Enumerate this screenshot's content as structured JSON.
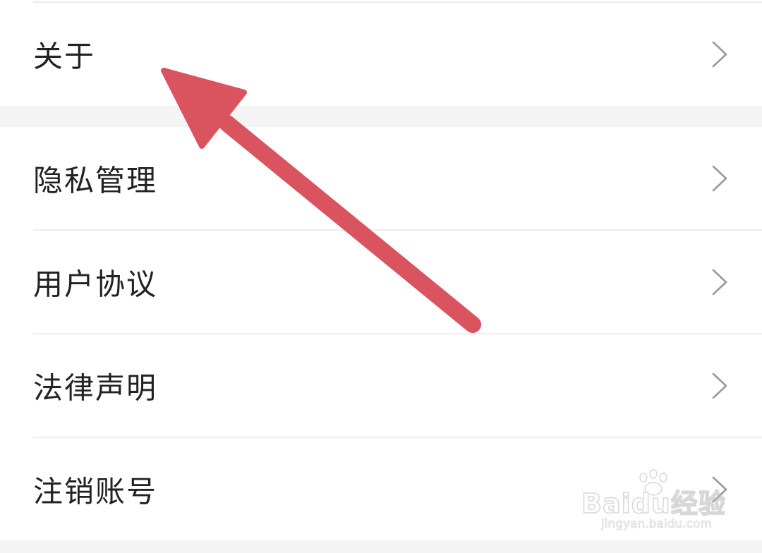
{
  "settings_top": {
    "items": [
      {
        "label": "关于"
      }
    ]
  },
  "settings_main": {
    "items": [
      {
        "label": "隐私管理"
      },
      {
        "label": "用户协议"
      },
      {
        "label": "法律声明"
      },
      {
        "label": "注销账号"
      }
    ]
  },
  "icons": {
    "row_chevron": "chevron-right-icon",
    "annotation": "red-arrow-annotation"
  },
  "colors": {
    "page_background": "#f4f4f4",
    "row_background": "#ffffff",
    "label_text": "#222222",
    "chevron": "#999999",
    "annotation_arrow": "#d9545f"
  },
  "watermark": {
    "logo": "Baidu经验",
    "url": "jingyan.baidu.com"
  }
}
